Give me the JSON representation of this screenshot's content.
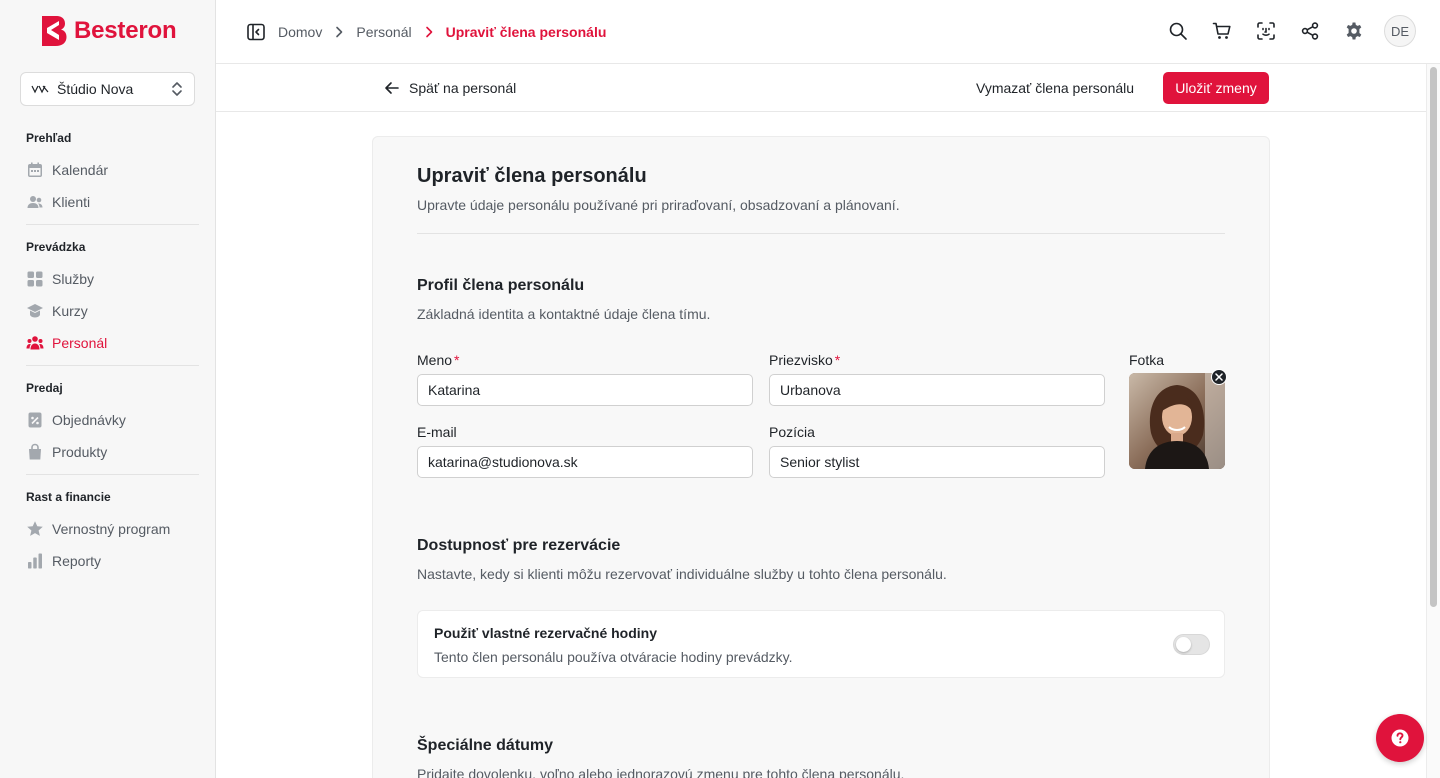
{
  "brand": {
    "name": "Besteron",
    "accent": "#e0133c"
  },
  "studio": {
    "name": "Štúdio Nova"
  },
  "sidebar": {
    "sections": [
      {
        "heading": "Prehľad",
        "items": [
          {
            "label": "Kalendár",
            "icon": "calendar-icon"
          },
          {
            "label": "Klienti",
            "icon": "users-icon"
          }
        ]
      },
      {
        "heading": "Prevádzka",
        "items": [
          {
            "label": "Služby",
            "icon": "grid-icon"
          },
          {
            "label": "Kurzy",
            "icon": "graduation-cap-icon"
          },
          {
            "label": "Personál",
            "icon": "team-icon",
            "active": true
          }
        ]
      },
      {
        "heading": "Predaj",
        "items": [
          {
            "label": "Objednávky",
            "icon": "orders-icon"
          },
          {
            "label": "Produkty",
            "icon": "bag-icon"
          }
        ]
      },
      {
        "heading": "Rast a financie",
        "items": [
          {
            "label": "Vernostný program",
            "icon": "star-icon"
          },
          {
            "label": "Reporty",
            "icon": "bar-chart-icon"
          }
        ]
      }
    ]
  },
  "breadcrumb": {
    "items": [
      "Domov",
      "Personál"
    ],
    "current": "Upraviť člena personálu"
  },
  "user": {
    "initials": "DE"
  },
  "actions": {
    "back": "Späť na personál",
    "delete": "Vymazať člena personálu",
    "save": "Uložiť zmeny"
  },
  "page": {
    "title": "Upraviť člena personálu",
    "subtitle": "Upravte údaje personálu používané pri priraďovaní, obsadzovaní a plánovaní."
  },
  "profile": {
    "title": "Profil člena personálu",
    "subtitle": "Základná identita a kontaktné údaje člena tímu.",
    "first_name_label": "Meno",
    "first_name": "Katarina",
    "last_name_label": "Priezvisko",
    "last_name": "Urbanova",
    "email_label": "E-mail",
    "email": "katarina@studionova.sk",
    "position_label": "Pozícia",
    "position": "Senior stylist",
    "photo_label": "Fotka",
    "required_mark": "*"
  },
  "availability": {
    "title": "Dostupnosť pre rezervácie",
    "subtitle": "Nastavte, kedy si klienti môžu rezervovať individuálne služby u tohto člena personálu.",
    "toggle_title": "Použiť vlastné rezervačné hodiny",
    "toggle_sub": "Tento člen personálu používa otváracie hodiny prevádzky.",
    "toggle_on": false
  },
  "special_dates": {
    "title": "Špeciálne dátumy",
    "subtitle": "Pridajte dovolenku, voľno alebo jednorazovú zmenu pre tohto člena personálu."
  }
}
